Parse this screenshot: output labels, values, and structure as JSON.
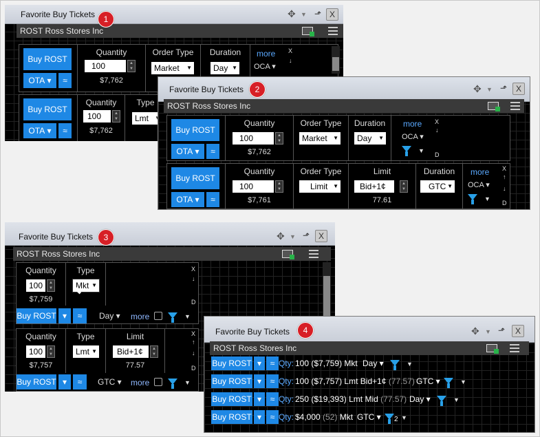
{
  "window_title": "Favorite Buy Tickets",
  "symbol_bar": "ROST Ross Stores Inc",
  "badges": [
    "1",
    "2",
    "3",
    "4"
  ],
  "labels": {
    "quantity": "Quantity",
    "order_type": "Order Type",
    "type": "Type",
    "duration": "Duration",
    "limit": "Limit",
    "more": "more",
    "close": "X",
    "x": "X",
    "d": "D"
  },
  "buttons": {
    "buy": "Buy ROST",
    "ota": "OTA"
  },
  "w1": {
    "r1": {
      "qty": "100",
      "total": "$7,762",
      "order_type": "Market",
      "duration": "Day",
      "oca": "OCA"
    },
    "r2": {
      "qty": "100",
      "total": "$7,762",
      "type": "Lmt"
    }
  },
  "w2": {
    "r1": {
      "qty": "100",
      "total": "$7,762",
      "order_type": "Market",
      "duration": "Day",
      "oca": "OCA"
    },
    "r2": {
      "qty": "100",
      "total": "$7,761",
      "order_type": "Limit",
      "limit": "Bid+1¢",
      "limit_val": "77.61",
      "duration": "GTC",
      "oca": "OCA"
    }
  },
  "w3": {
    "r1": {
      "qty": "100",
      "total": "$7,759",
      "type": "Mkt",
      "duration": "Day"
    },
    "r2": {
      "qty": "100",
      "total": "$7,757",
      "type": "Lmt",
      "limit": "Bid+1¢",
      "limit_val": "77.57",
      "duration": "GTC"
    }
  },
  "w4": {
    "rows": [
      {
        "qty": "100",
        "paren": "($7,759)",
        "type": "Mkt",
        "duration": "Day",
        "extra": ""
      },
      {
        "qty": "100",
        "paren": "($7,757)",
        "type": "Lmt",
        "extra": "Bid+1¢",
        "paren2": "(77.57)",
        "duration": "GTC"
      },
      {
        "qty": "250",
        "paren": "($19,393)",
        "type": "Lmt",
        "extra": "Mid",
        "paren2": "(77.57)",
        "duration": "Day"
      },
      {
        "qty": "$4,000",
        "paren": "(52)",
        "type": "Mkt",
        "duration": "GTC",
        "sub": "2"
      }
    ],
    "qty_label": "Qty:"
  },
  "colors": {
    "accent": "#1e88e5",
    "badge": "#d71f26",
    "funnel": "#28a0e8"
  }
}
